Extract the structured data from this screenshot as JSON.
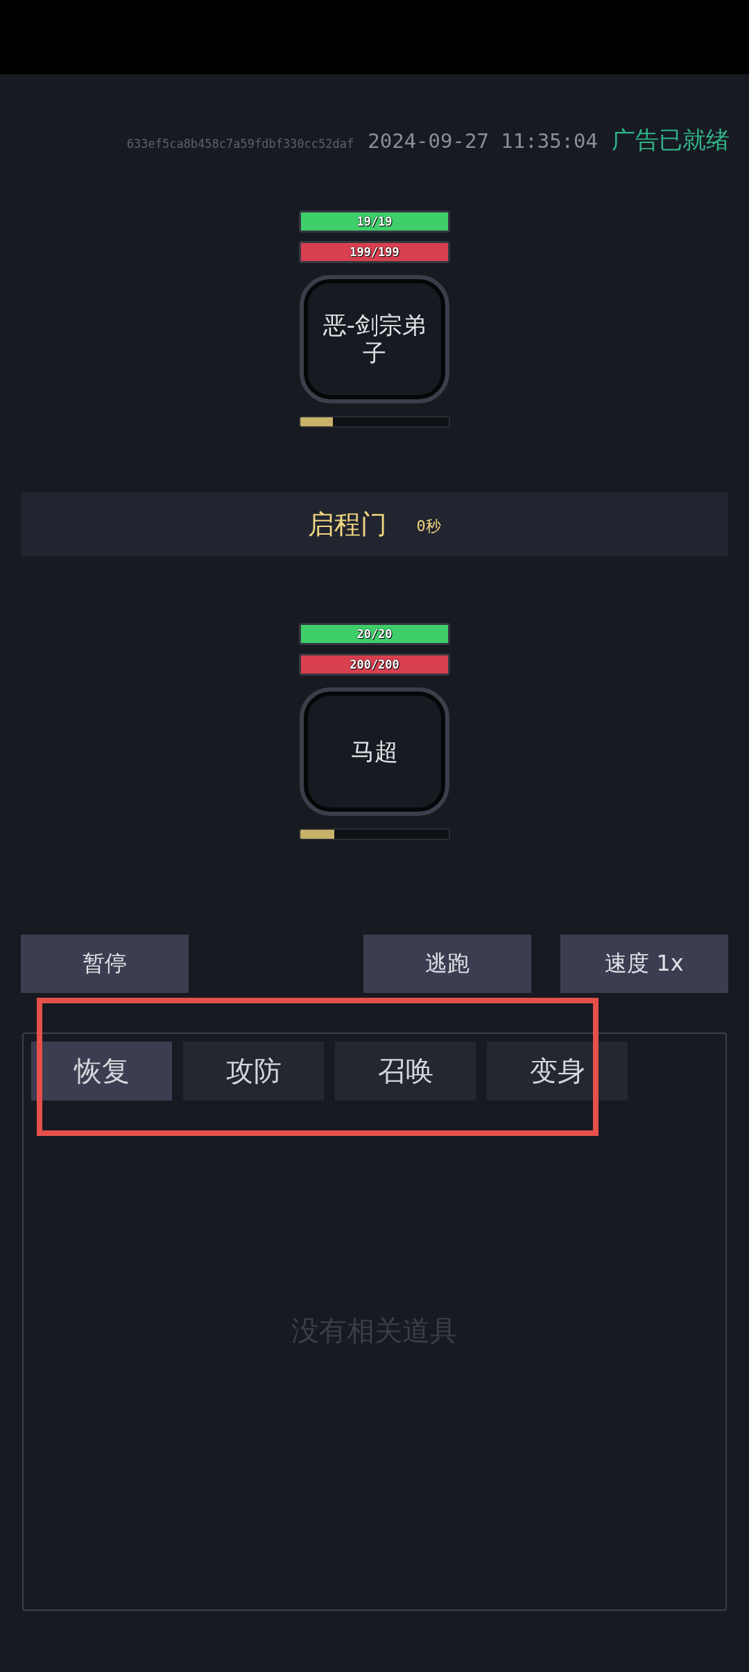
{
  "header": {
    "device_id": "633ef5ca8b458c7a59fdbf330cc52daf",
    "datetime": "2024-09-27 11:35:04",
    "ad_status": "广告已就绪"
  },
  "enemy": {
    "name": "恶-剑宗弟子",
    "hp": {
      "text": "19/19",
      "level": 1
    },
    "mp": {
      "text": "199/199",
      "level": 1
    },
    "charge": {
      "level": 0.22
    }
  },
  "stage": {
    "name": "启程门",
    "timer": "0秒"
  },
  "player": {
    "name": "马超",
    "hp": {
      "text": "20/20",
      "level": 1
    },
    "mp": {
      "text": "200/200",
      "level": 1
    },
    "charge": {
      "level": 0.23
    }
  },
  "controls": [
    {
      "label": "暂停"
    },
    {
      "label": "逃跑"
    },
    {
      "label": "速度 1x"
    }
  ],
  "item_tabs": [
    {
      "label": "恢复",
      "selected": true
    },
    {
      "label": "攻防",
      "selected": false
    },
    {
      "label": "召唤",
      "selected": false
    },
    {
      "label": "变身",
      "selected": false
    }
  ],
  "empty_message": "没有相关道具"
}
